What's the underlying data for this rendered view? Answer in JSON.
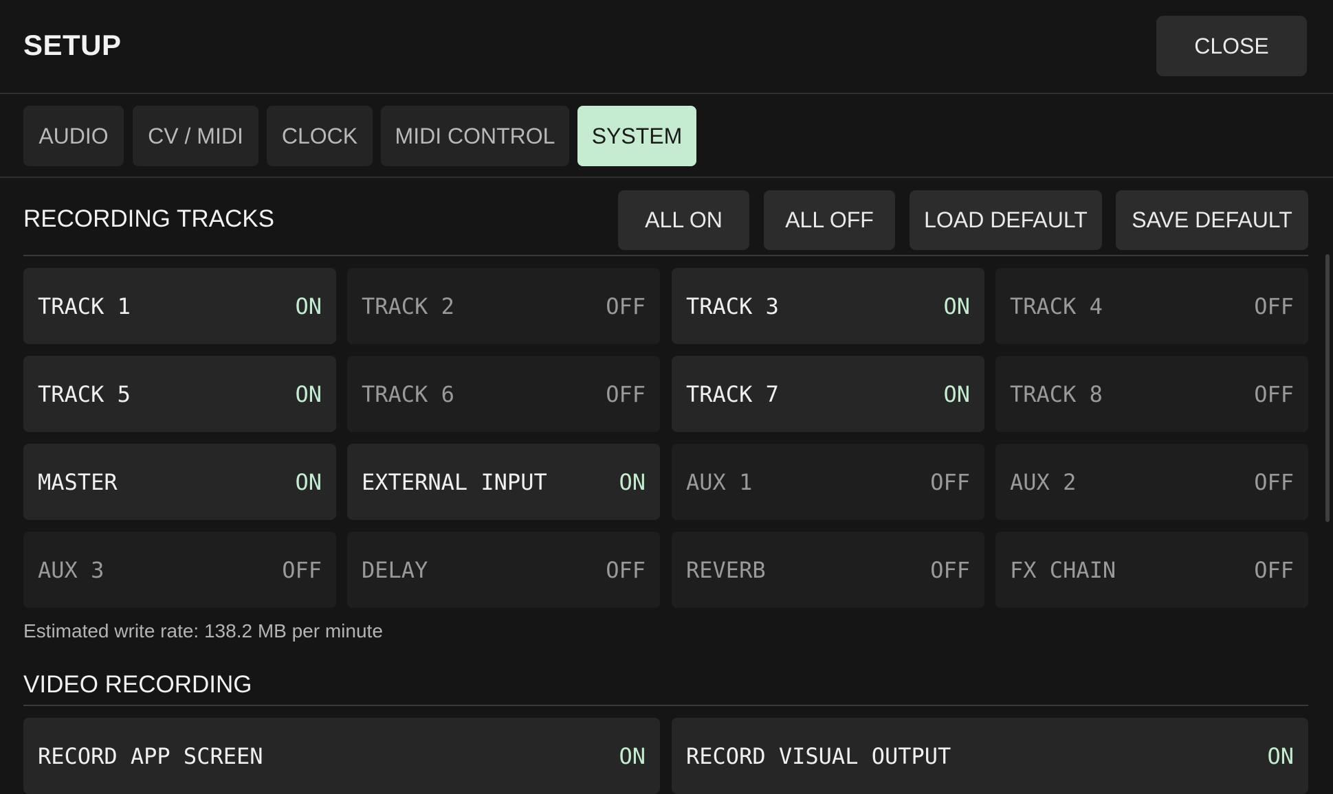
{
  "header": {
    "title": "SETUP",
    "close_label": "CLOSE"
  },
  "tabs": [
    {
      "label": "AUDIO",
      "active": false
    },
    {
      "label": "CV / MIDI",
      "active": false
    },
    {
      "label": "CLOCK",
      "active": false
    },
    {
      "label": "MIDI CONTROL",
      "active": false
    },
    {
      "label": "SYSTEM",
      "active": true
    }
  ],
  "recording_tracks": {
    "title": "RECORDING TRACKS",
    "actions": [
      "ALL ON",
      "ALL OFF",
      "LOAD DEFAULT",
      "SAVE DEFAULT"
    ],
    "tracks": [
      {
        "label": "TRACK 1",
        "state": "ON"
      },
      {
        "label": "TRACK 2",
        "state": "OFF"
      },
      {
        "label": "TRACK 3",
        "state": "ON"
      },
      {
        "label": "TRACK 4",
        "state": "OFF"
      },
      {
        "label": "TRACK 5",
        "state": "ON"
      },
      {
        "label": "TRACK 6",
        "state": "OFF"
      },
      {
        "label": "TRACK 7",
        "state": "ON"
      },
      {
        "label": "TRACK 8",
        "state": "OFF"
      },
      {
        "label": "MASTER",
        "state": "ON"
      },
      {
        "label": "EXTERNAL INPUT",
        "state": "ON"
      },
      {
        "label": "AUX 1",
        "state": "OFF"
      },
      {
        "label": "AUX 2",
        "state": "OFF"
      },
      {
        "label": "AUX 3",
        "state": "OFF"
      },
      {
        "label": "DELAY",
        "state": "OFF"
      },
      {
        "label": "REVERB",
        "state": "OFF"
      },
      {
        "label": "FX CHAIN",
        "state": "OFF"
      }
    ],
    "write_rate_note": "Estimated write rate: 138.2 MB per minute"
  },
  "video_recording": {
    "title": "VIDEO RECORDING",
    "options": [
      {
        "label": "RECORD APP SCREEN",
        "state": "ON"
      },
      {
        "label": "RECORD VISUAL OUTPUT",
        "state": "ON"
      }
    ]
  },
  "colors": {
    "accent": "#c5ecd1",
    "on_text": "#c3edcf",
    "background": "#151515",
    "tile": "#262626"
  }
}
